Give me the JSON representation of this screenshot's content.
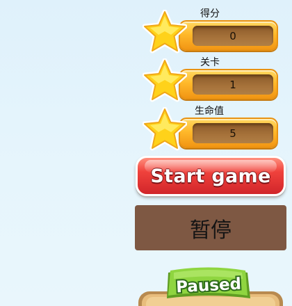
{
  "hud": {
    "score": {
      "label": "得分",
      "value": "0"
    },
    "level": {
      "label": "关卡",
      "value": "1"
    },
    "lives": {
      "label": "生命值",
      "value": "5"
    }
  },
  "buttons": {
    "start_label": "Start game",
    "pause_label": "暂停"
  },
  "paused_banner": {
    "title": "Paused"
  },
  "colors": {
    "background": "#e4f4fc",
    "hud_bar": "#ffb92b",
    "hud_value_box": "#9d6a35",
    "star": "#ffd21a",
    "start_button": "#e2302f",
    "pause_button": "#7e5843",
    "paused_ribbon": "#8fd540",
    "paused_panel": "#e2b574"
  },
  "icons": {
    "hud_icon": "star-icon"
  }
}
